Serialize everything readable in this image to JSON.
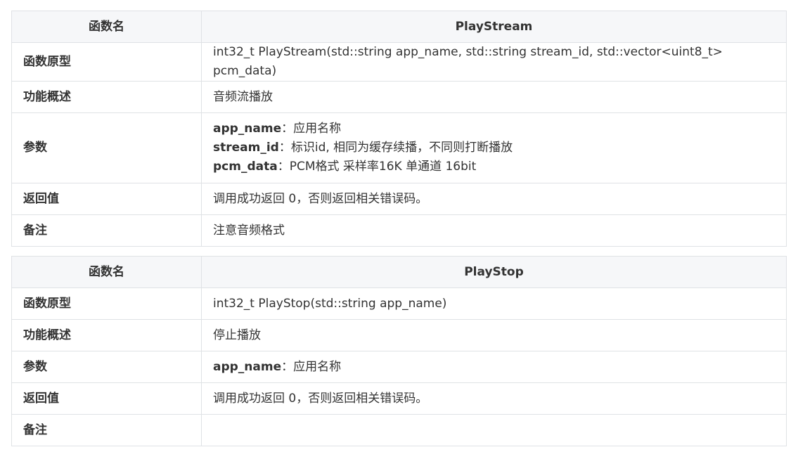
{
  "table1": {
    "header": {
      "col1": "函数名",
      "col2": "PlayStream"
    },
    "prototype": {
      "label": "函数原型",
      "value": "int32_t PlayStream(std::string app_name, std::string stream_id, std::vector<uint8_t> pcm_data)"
    },
    "summary": {
      "label": "功能概述",
      "value": "音频流播放"
    },
    "params": {
      "label": "参数",
      "items": [
        {
          "name": "app_name",
          "sep": "：",
          "desc": "应用名称"
        },
        {
          "name": "stream_id",
          "sep": "：",
          "desc": "标识id, 相同为缓存续播，不同则打断播放"
        },
        {
          "name": "pcm_data",
          "sep": "：",
          "desc": "PCM格式 采样率16K 单通道 16bit"
        }
      ]
    },
    "returns": {
      "label": "返回值",
      "value": "调用成功返回 0，否则返回相关错误码。"
    },
    "notes": {
      "label": "备注",
      "value": "注意音频格式"
    }
  },
  "table2": {
    "header": {
      "col1": "函数名",
      "col2": "PlayStop"
    },
    "prototype": {
      "label": "函数原型",
      "value": "int32_t PlayStop(std::string app_name)"
    },
    "summary": {
      "label": "功能概述",
      "value": "停止播放"
    },
    "params": {
      "label": "参数",
      "items": [
        {
          "name": "app_name",
          "sep": "：",
          "desc": "应用名称"
        }
      ]
    },
    "returns": {
      "label": "返回值",
      "value": "调用成功返回 0，否则返回相关错误码。"
    },
    "notes": {
      "label": "备注",
      "value": ""
    }
  }
}
